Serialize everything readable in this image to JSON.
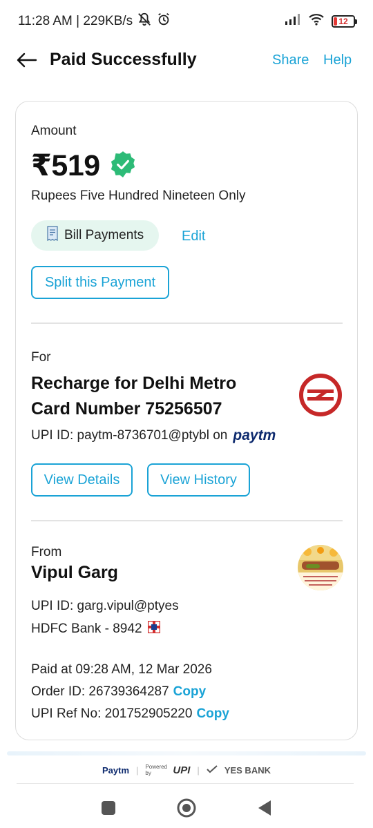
{
  "status_bar": {
    "time_speed": "11:28 AM | 229KB/s",
    "battery": "12"
  },
  "header": {
    "title": "Paid Successfully",
    "share": "Share",
    "help": "Help"
  },
  "amount": {
    "label": "Amount",
    "value": "₹519",
    "in_words": "Rupees Five Hundred Nineteen Only",
    "category": "Bill Payments",
    "edit": "Edit",
    "split_button": "Split this Payment"
  },
  "payee": {
    "label": "For",
    "title_line1": "Recharge for Delhi Metro",
    "title_line2": "Card Number 75256507",
    "upi_id": "UPI ID: paytm-8736701@ptybl on",
    "upi_provider": "paytm",
    "view_details": "View Details",
    "view_history": "View History"
  },
  "payer": {
    "label": "From",
    "name": "Vipul Garg",
    "upi_id": "UPI ID: garg.vipul@ptyes",
    "bank": "HDFC Bank - 8942",
    "paid_at": "Paid at 09:28 AM, 12 Mar 2026",
    "order_id": "Order ID: 26739364287",
    "upi_ref": "UPI Ref No: 201752905220",
    "copy": "Copy"
  },
  "footer": {
    "paytm": "Paytm",
    "powered_by": "Powered by",
    "upi": "UPI",
    "bank": "YES BANK"
  },
  "colors": {
    "accent": "#1aa3d6",
    "success": "#2dbb77",
    "pill_bg": "#e5f6ef",
    "metro_red": "#c62828"
  }
}
